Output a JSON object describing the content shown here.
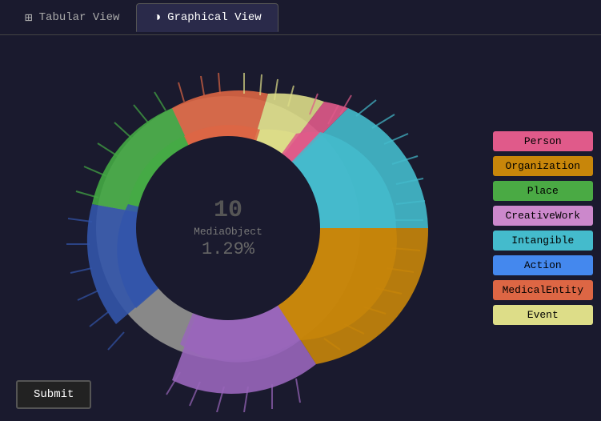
{
  "tabs": [
    {
      "id": "tabular",
      "label": "Tabular View",
      "icon": "⊞",
      "active": false
    },
    {
      "id": "graphical",
      "label": "Graphical View",
      "icon": "◑",
      "active": true
    }
  ],
  "chart": {
    "center_number": "10",
    "center_label": "MediaObject",
    "center_percent": "1.29%"
  },
  "legend": [
    {
      "id": "person",
      "label": "Person",
      "color": "#e05a8a"
    },
    {
      "id": "organization",
      "label": "Organization",
      "color": "#c8860a"
    },
    {
      "id": "place",
      "label": "Place",
      "color": "#4aaa44"
    },
    {
      "id": "creativework",
      "label": "CreativeWork",
      "color": "#cc88cc"
    },
    {
      "id": "intangible",
      "label": "Intangible",
      "color": "#44bbcc"
    },
    {
      "id": "action",
      "label": "Action",
      "color": "#4488ee"
    },
    {
      "id": "medicalentity",
      "label": "MedicalEntity",
      "color": "#dd6644"
    },
    {
      "id": "event",
      "label": "Event",
      "color": "#dddd88"
    }
  ],
  "submit_label": "Submit"
}
